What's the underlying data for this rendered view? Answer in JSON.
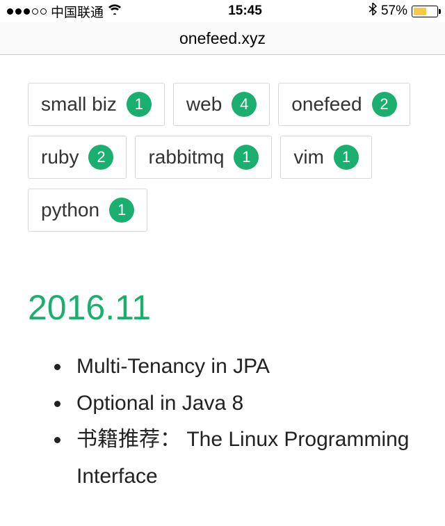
{
  "status": {
    "carrier": "中国联通",
    "time": "15:45",
    "battery_pct": "57%",
    "battery_fill_pct": 57
  },
  "url": "onefeed.xyz",
  "tags": [
    {
      "label": "small biz",
      "count": "1"
    },
    {
      "label": "web",
      "count": "4"
    },
    {
      "label": "onefeed",
      "count": "2"
    },
    {
      "label": "ruby",
      "count": "2"
    },
    {
      "label": "rabbitmq",
      "count": "1"
    },
    {
      "label": "vim",
      "count": "1"
    },
    {
      "label": "python",
      "count": "1"
    }
  ],
  "section": {
    "title": "2016.11",
    "posts": [
      "Multi-Tenancy in JPA",
      "Optional in Java 8",
      "书籍推荐： The Linux Programming Interface"
    ]
  },
  "colors": {
    "accent": "#1aae6f",
    "battery": "#f7c948"
  }
}
